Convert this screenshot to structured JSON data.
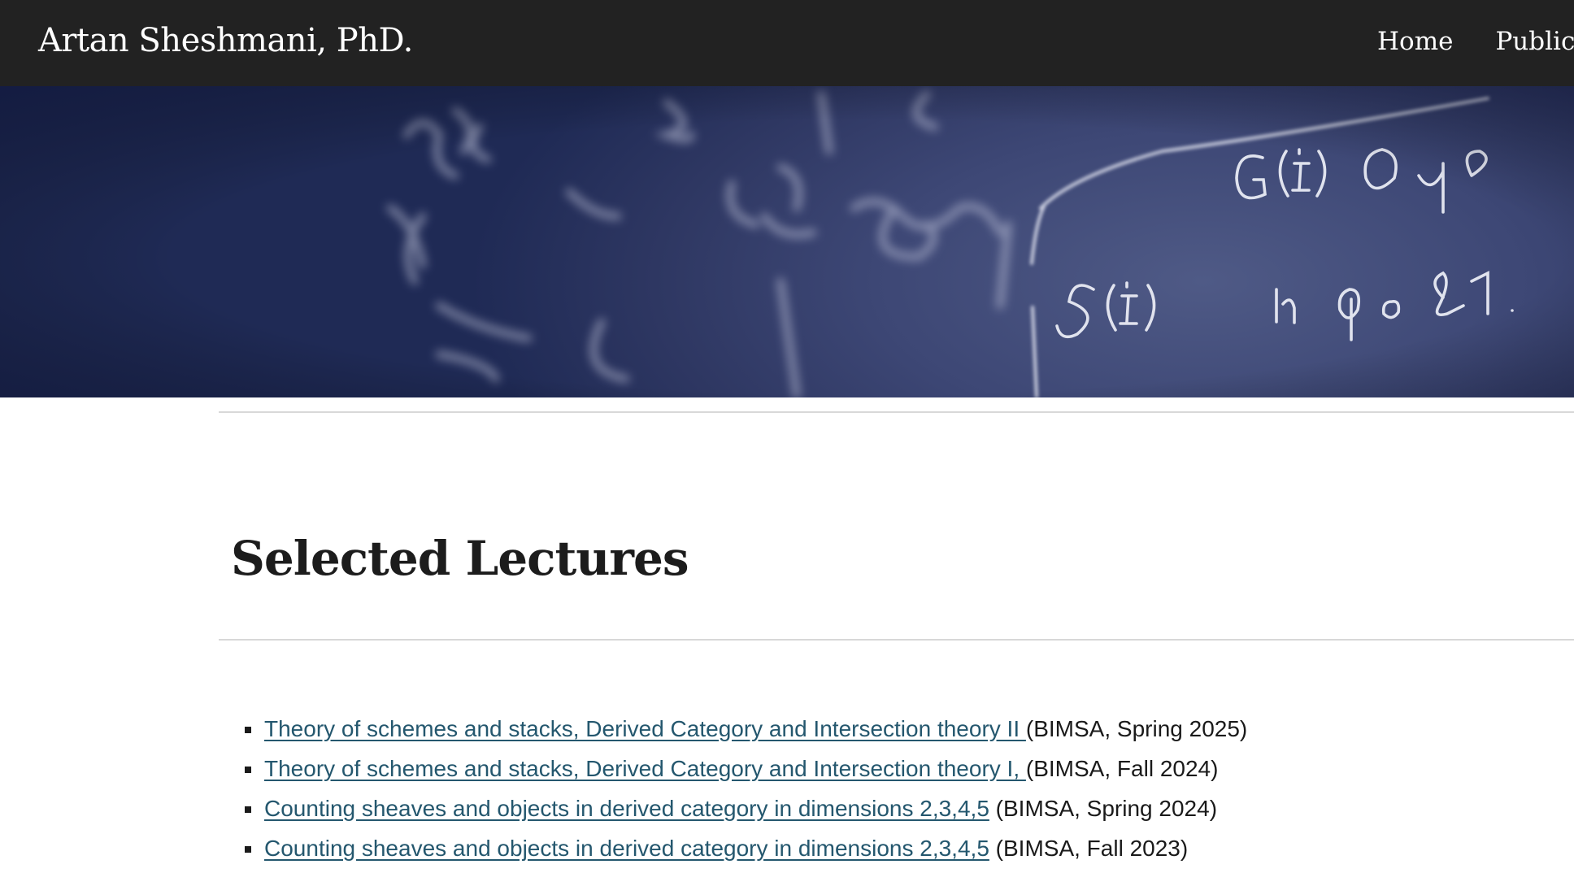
{
  "header": {
    "site_title": "Artan Sheshmani, PhD.",
    "nav": [
      {
        "label": "Home"
      },
      {
        "label": "Publica"
      }
    ]
  },
  "hero": {
    "chalk_writing": [
      "G(I) ≅ O",
      "S(I)",
      "in",
      "&1."
    ]
  },
  "main": {
    "title": "Selected Lectures",
    "lectures": [
      {
        "link": "Theory of schemes and stacks, Derived Category and Intersection theory II ",
        "detail": "(BIMSA, Spring 2025)"
      },
      {
        "link": "Theory of schemes and stacks, Derived Category and Intersection theory I,  ",
        "detail": "(BIMSA, Fall 2024)"
      },
      {
        "link": "Counting sheaves and objects in derived category in dimensions 2,3,4,5",
        "detail": " (BIMSA, Spring 2024)"
      },
      {
        "link": "Counting sheaves and objects in derived category in dimensions 2,3,4,5",
        "detail": " (BIMSA, Fall 2023)"
      }
    ]
  },
  "colors": {
    "navbar_bg": "#222222",
    "link": "#24576e",
    "hero_bg": "#2e3762",
    "rule": "#d8d8d8"
  }
}
